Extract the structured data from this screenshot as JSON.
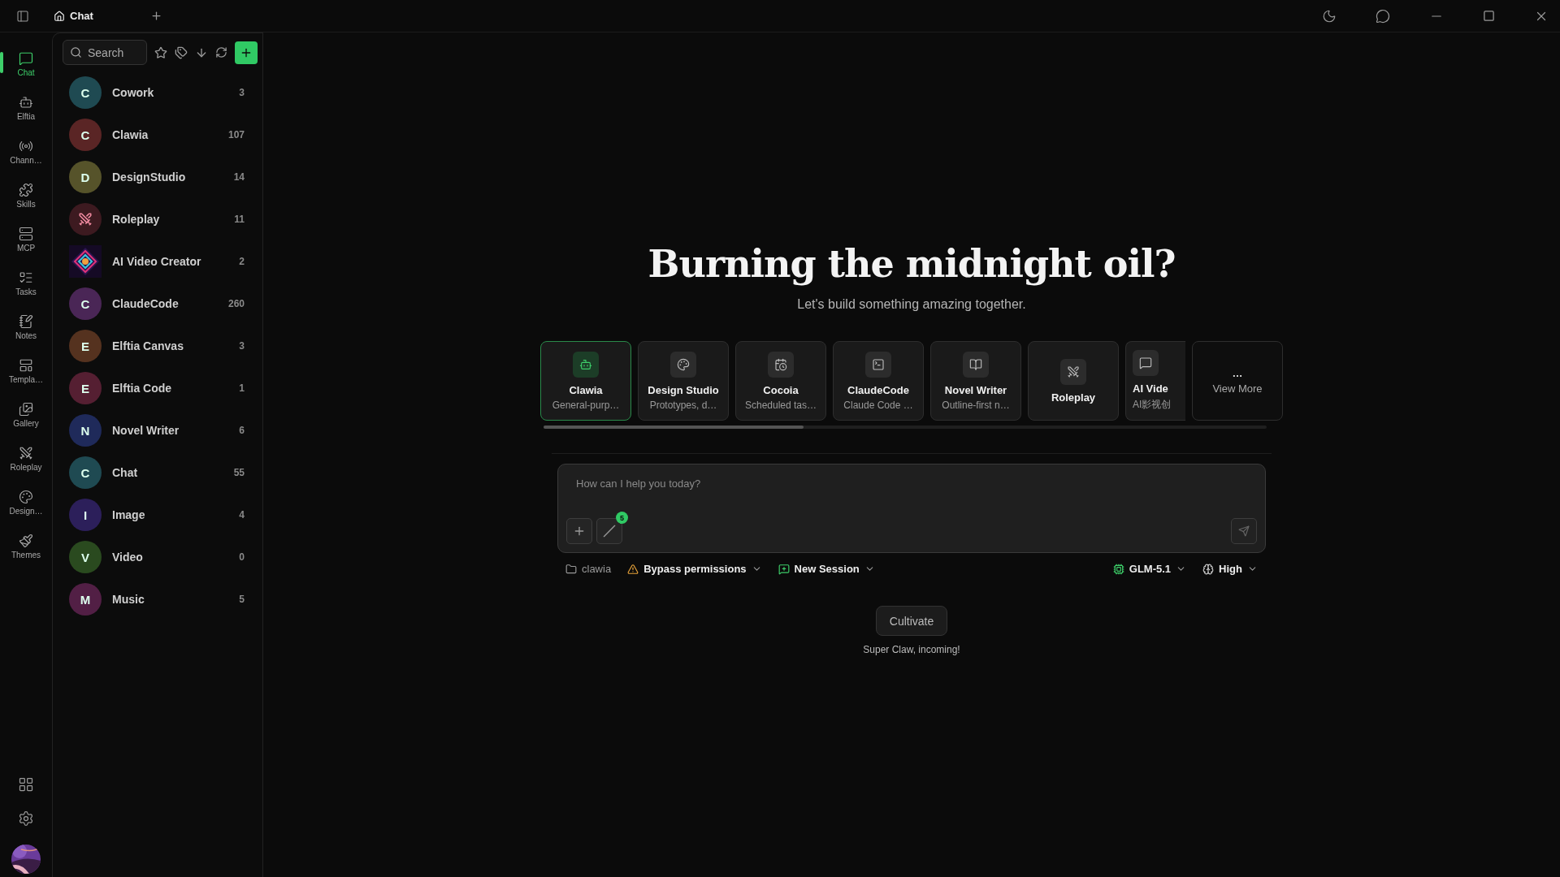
{
  "titlebar": {
    "tab": "Chat"
  },
  "rail": [
    {
      "label": "Chat",
      "selected": true
    },
    {
      "label": "Elftia",
      "selected": false
    },
    {
      "label": "Chann…",
      "selected": false
    },
    {
      "label": "Skills",
      "selected": false
    },
    {
      "label": "MCP",
      "selected": false
    },
    {
      "label": "Tasks",
      "selected": false
    },
    {
      "label": "Notes",
      "selected": false
    },
    {
      "label": "Templa…",
      "selected": false
    },
    {
      "label": "Gallery",
      "selected": false
    },
    {
      "label": "Roleplay",
      "selected": false
    },
    {
      "label": "Design…",
      "selected": false
    },
    {
      "label": "Themes",
      "selected": false
    }
  ],
  "sidebar": {
    "search": {
      "placeholder": "Search"
    },
    "items": [
      {
        "kind": "letter",
        "letter": "C",
        "name": "Cowork",
        "count": "3",
        "color": "#1f4a52"
      },
      {
        "kind": "letter",
        "letter": "C",
        "name": "Clawia",
        "count": "107",
        "color": "#5a2525"
      },
      {
        "kind": "letter",
        "letter": "D",
        "name": "DesignStudio",
        "count": "14",
        "color": "#56532a"
      },
      {
        "kind": "icon",
        "name": "Roleplay",
        "count": "11",
        "color": "#3d1a20"
      },
      {
        "kind": "picture",
        "name": "AI Video Creator",
        "count": "2"
      },
      {
        "kind": "letter",
        "letter": "C",
        "name": "ClaudeCode",
        "count": "260",
        "color": "#4a2656"
      },
      {
        "kind": "letter",
        "letter": "E",
        "name": "Elftia Canvas",
        "count": "3",
        "color": "#55321f"
      },
      {
        "kind": "letter",
        "letter": "E",
        "name": "Elftia Code",
        "count": "1",
        "color": "#551f32"
      },
      {
        "kind": "letter",
        "letter": "N",
        "name": "Novel Writer",
        "count": "6",
        "color": "#1f2a5a"
      },
      {
        "kind": "letter",
        "letter": "C",
        "name": "Chat",
        "count": "55",
        "color": "#1f4a52"
      },
      {
        "kind": "letter",
        "letter": "I",
        "name": "Image",
        "count": "4",
        "color": "#2c1f5a"
      },
      {
        "kind": "letter",
        "letter": "V",
        "name": "Video",
        "count": "0",
        "color": "#2a4a1f"
      },
      {
        "kind": "letter",
        "letter": "M",
        "name": "Music",
        "count": "5",
        "color": "#521f45"
      }
    ]
  },
  "main": {
    "heading": "Burning the midnight oil?",
    "subtitle": "Let's build something amazing together.",
    "agents": [
      {
        "name": "Clawia",
        "desc": "General-purp…",
        "selected": true
      },
      {
        "name": "Design Studio",
        "desc": "Prototypes, d…",
        "selected": false
      },
      {
        "name": "Cocoia",
        "desc": "Scheduled tas…",
        "selected": false
      },
      {
        "name": "ClaudeCode",
        "desc": "Claude Code …",
        "selected": false
      },
      {
        "name": "Novel Writer",
        "desc": "Outline-first n…",
        "selected": false
      },
      {
        "name": "Roleplay",
        "selected": false
      },
      {
        "name": "AI Vide",
        "desc": "AI影视创",
        "selected": false
      }
    ],
    "view_more": {
      "icon": "…",
      "label": "View More"
    },
    "composer": {
      "placeholder": "How can I help you today?",
      "badge": "5"
    },
    "options": {
      "folder": "clawia",
      "permissions": "Bypass permissions",
      "session": "New Session",
      "model": "GLM-5.1",
      "effort": "High"
    },
    "cultivate": {
      "button": "Cultivate",
      "caption": "Super Claw, incoming!"
    }
  }
}
